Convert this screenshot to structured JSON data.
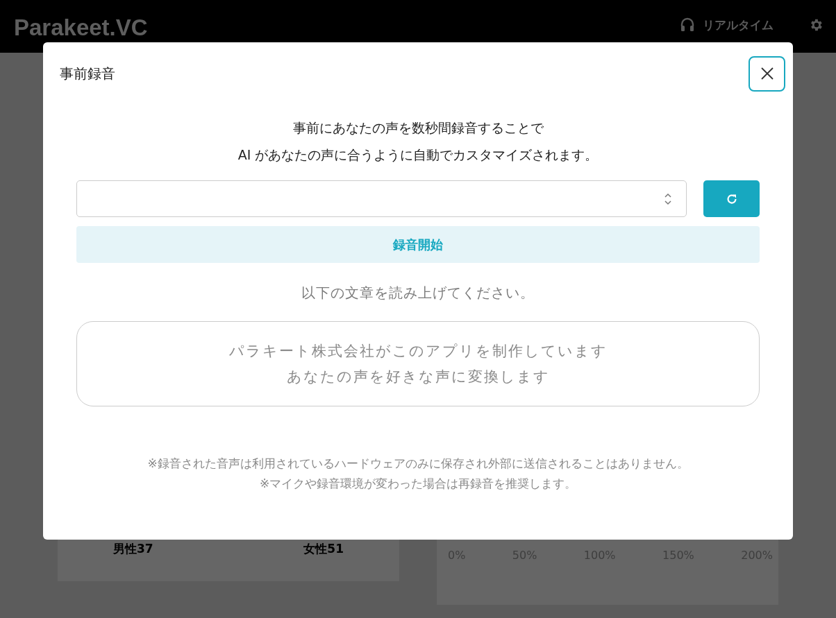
{
  "header": {
    "logo": "Parakeet.VC",
    "mode_label": "リアルタイム"
  },
  "background": {
    "left_card": {
      "labels": [
        "男性37",
        "女性51"
      ]
    },
    "right_card": {
      "axis_labels": [
        "0%",
        "50%",
        "100%",
        "150%",
        "200%"
      ]
    }
  },
  "dialog": {
    "title": "事前録音",
    "description": [
      "事前にあなたの声を数秒間録音することで",
      "AI があなたの声に合うように自動でカスタマイズされます。"
    ],
    "record_button": "録音開始",
    "instruction": "以下の文章を読み上げてください。",
    "script_lines": [
      "パラキート株式会社がこのアプリを制作しています",
      "あなたの声を好きな声に変換します"
    ],
    "notes": [
      "※録音された音声は利用されているハードウェアのみに保存され外部に送信されることはありません。",
      "※マイクや録音環境が変わった場合は再録音を推奨します。"
    ]
  }
}
